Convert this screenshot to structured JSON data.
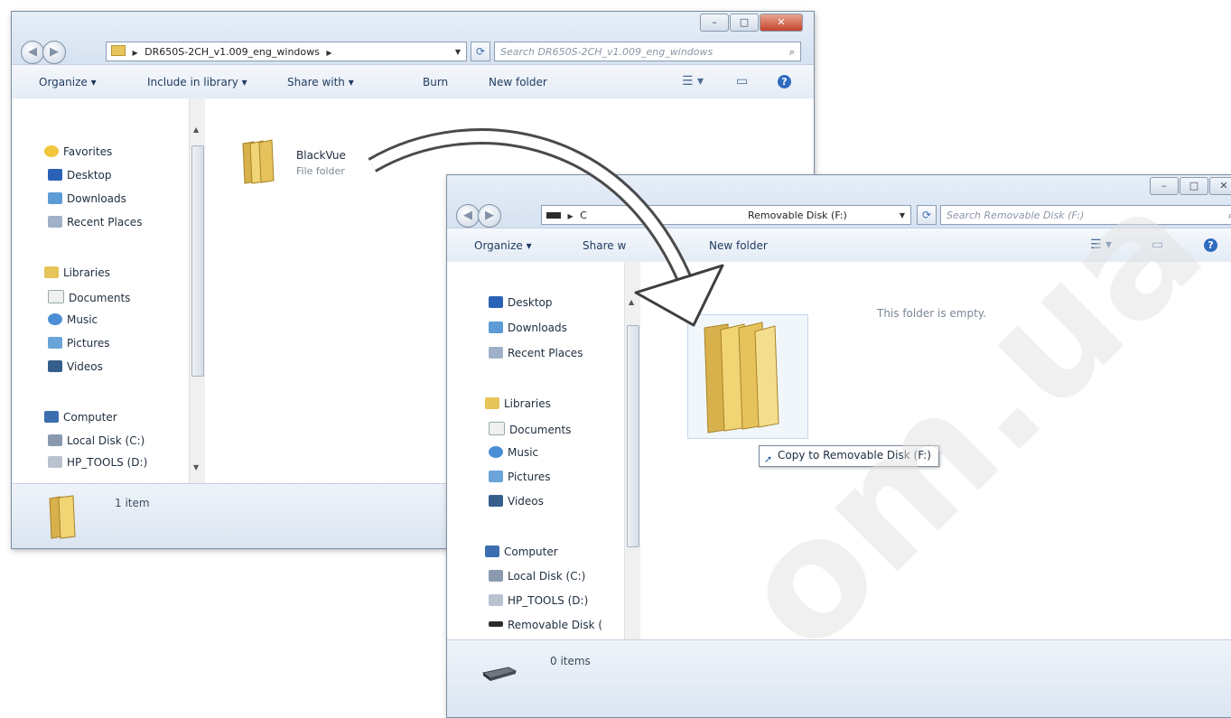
{
  "window1": {
    "path": "DR650S-2CH_v1.009_eng_windows",
    "search_placeholder": "Search DR650S-2CH_v1.009_eng_windows",
    "toolbar": {
      "organize": "Organize ▾",
      "include": "Include in library ▾",
      "share": "Share with ▾",
      "burn": "Burn",
      "new_folder": "New folder"
    },
    "nav": {
      "favorites": "Favorites",
      "desktop": "Desktop",
      "downloads": "Downloads",
      "recent": "Recent Places",
      "libraries": "Libraries",
      "documents": "Documents",
      "music": "Music",
      "pictures": "Pictures",
      "videos": "Videos",
      "computer": "Computer",
      "local_disk": "Local Disk (C:)",
      "hp_tools": "HP_TOOLS (D:)"
    },
    "file": {
      "name": "BlackVue",
      "type": "File folder"
    },
    "status": "1 item"
  },
  "window2": {
    "path_start": "C",
    "path_end": "Removable Disk (F:)",
    "search_placeholder": "Search Removable Disk (F:)",
    "toolbar": {
      "organize": "Organize ▾",
      "share": "Share w",
      "new_folder": "New folder"
    },
    "nav": {
      "desktop": "Desktop",
      "downloads": "Downloads",
      "recent": "Recent Places",
      "libraries": "Libraries",
      "documents": "Documents",
      "music": "Music",
      "pictures": "Pictures",
      "videos": "Videos",
      "computer": "Computer",
      "local_disk": "Local Disk (C:)",
      "hp_tools": "HP_TOOLS (D:)",
      "removable": "Removable Disk ("
    },
    "empty_text": "This folder is empty.",
    "status": "0 items"
  },
  "tooltip": "Copy to Removable Disk (F:)",
  "watermark": "om.ua"
}
